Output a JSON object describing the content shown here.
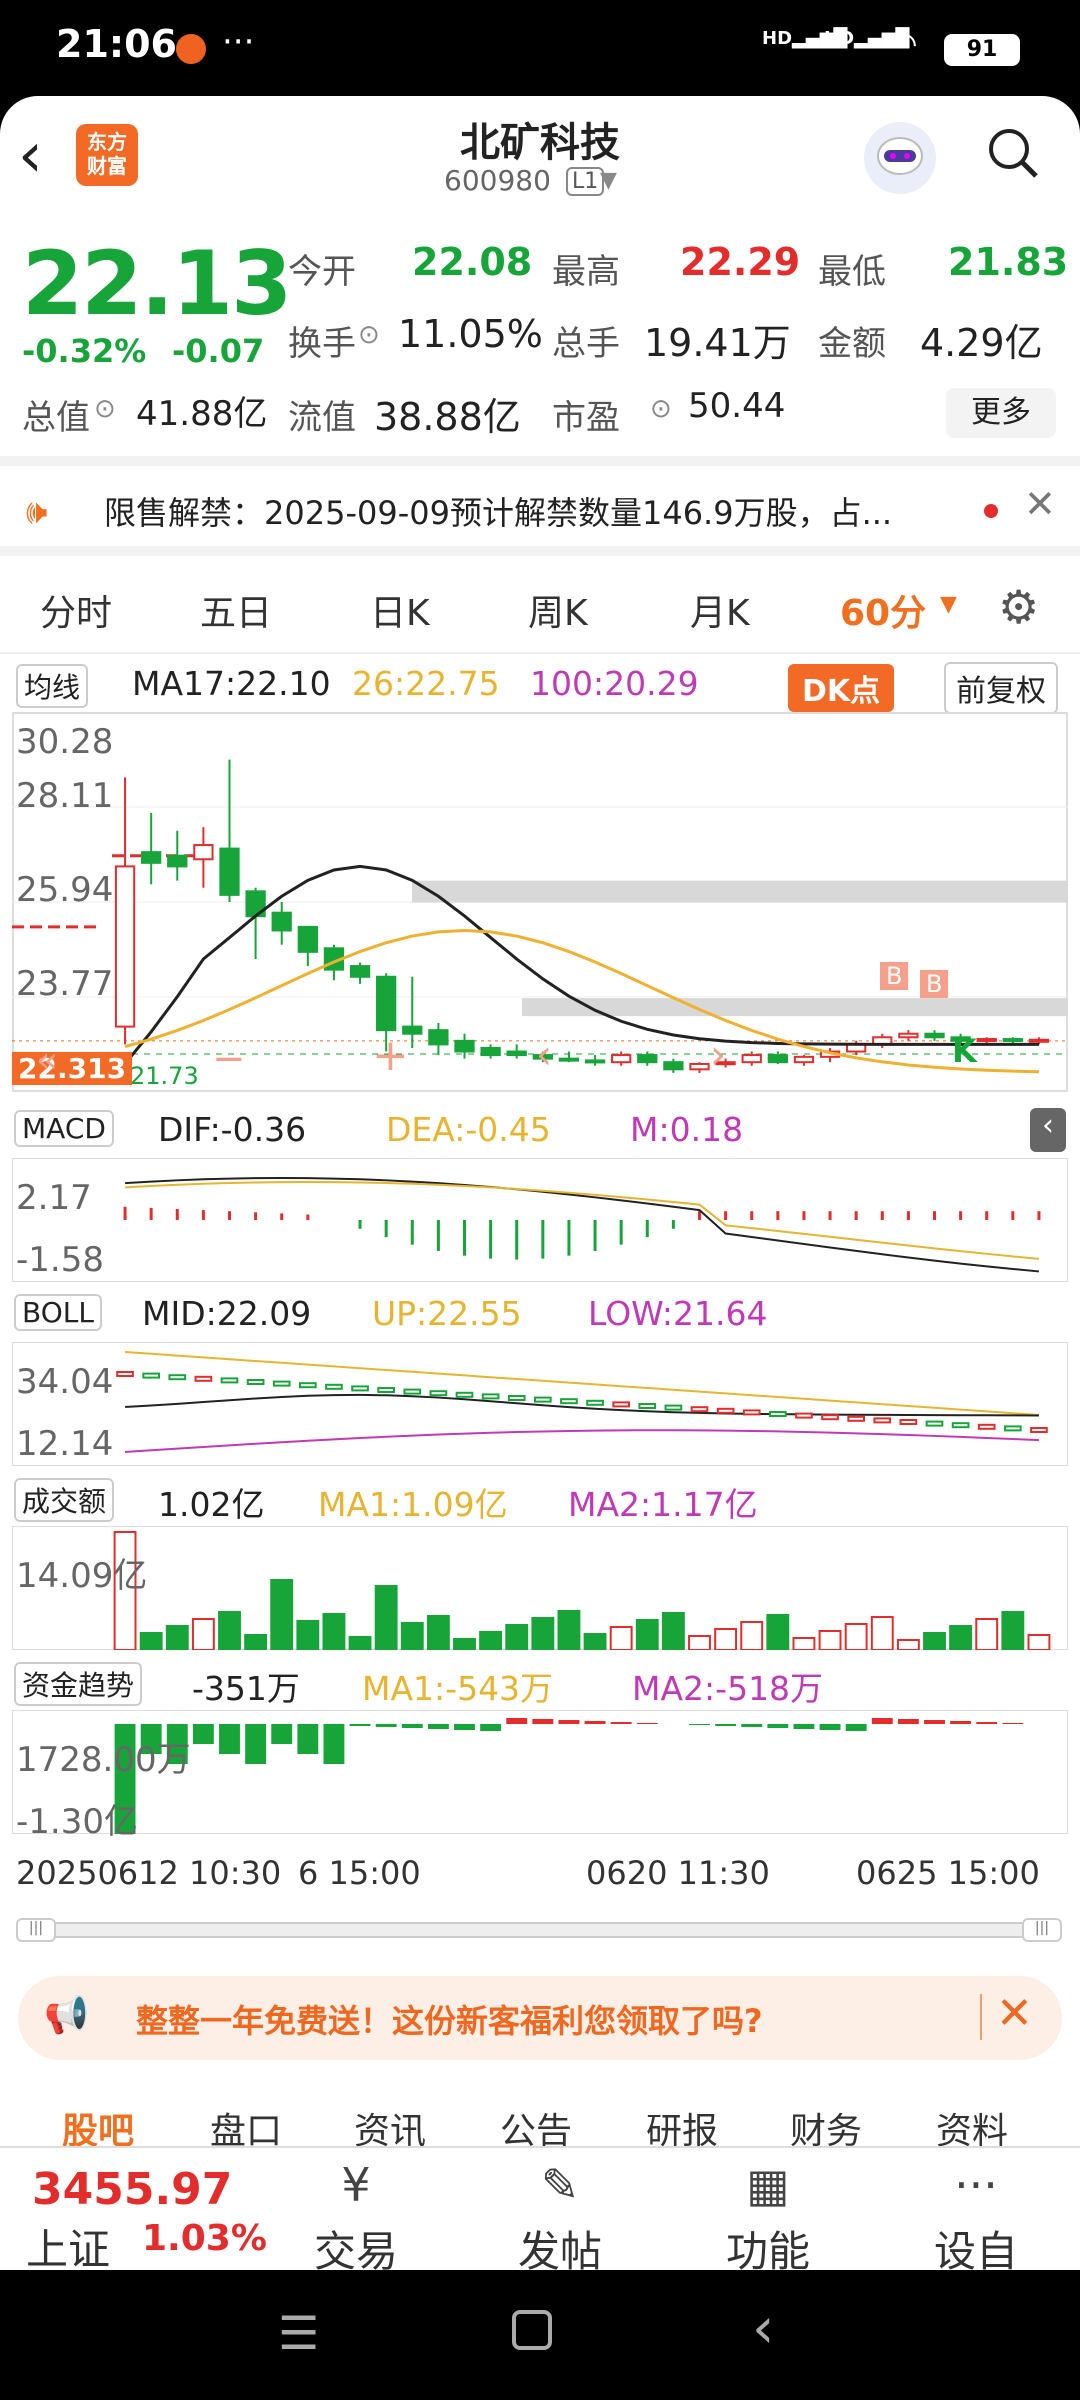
{
  "status": {
    "time": "21:06",
    "net1": "HD",
    "net2": "HD",
    "battery": "91"
  },
  "header": {
    "logo": "东方\n财富",
    "title": "北矿科技",
    "code": "600980",
    "level": "L1"
  },
  "quote": {
    "price": "22.13",
    "pct": "-0.32%",
    "chg": "-0.07",
    "row1": [
      {
        "l": "今开",
        "v": "22.08",
        "c": "green"
      },
      {
        "l": "最高",
        "v": "22.29",
        "c": "red"
      },
      {
        "l": "最低",
        "v": "21.83",
        "c": "green"
      }
    ],
    "row2": [
      {
        "l": "换手",
        "v": "11.05%"
      },
      {
        "l": "总手",
        "v": "19.41万"
      },
      {
        "l": "金额",
        "v": "4.29亿"
      }
    ],
    "row3": [
      {
        "l": "总值",
        "v": "41.88亿"
      },
      {
        "l": "流值",
        "v": "38.88亿"
      },
      {
        "l": "市盈",
        "v": "50.44"
      }
    ],
    "more": "更多"
  },
  "notice": {
    "text": "限售解禁：2025-09-09预计解禁数量146.9万股，占..."
  },
  "tabs": [
    "分时",
    "五日",
    "日K",
    "周K",
    "月K",
    "60分"
  ],
  "active_tab": "60分",
  "chart": {
    "ma_sel": "均线",
    "ma17": "MA17:22.10",
    "ma26": "26:22.75",
    "ma100": "100:20.29",
    "dk": "DK点",
    "fq": "前复权",
    "yticks": [
      "30.28",
      "28.11",
      "25.94",
      "23.77"
    ],
    "price_tag": "22.313",
    "low_tag": "21.73",
    "macd_sel": "MACD",
    "dif": "DIF:-0.36",
    "dea": "DEA:-0.45",
    "m": "M:0.18",
    "macd_hi": "2.17",
    "macd_lo": "-1.58",
    "boll_sel": "BOLL",
    "mid": "MID:22.09",
    "up": "UP:22.55",
    "low": "LOW:21.64",
    "boll_hi": "34.04",
    "boll_lo": "12.14",
    "vol_sel": "成交额",
    "vol": "1.02亿",
    "vma1": "MA1:1.09亿",
    "vma2": "MA2:1.17亿",
    "vol_hi": "14.09亿",
    "fund_sel": "资金趋势",
    "fund": "-351万",
    "fma1": "MA1:-543万",
    "fma2": "MA2:-518万",
    "fund_hi": "1728.00万",
    "fund_lo": "-1.30亿",
    "xlabels": [
      "20250612 10:30",
      "6 15:00",
      "0620 11:30",
      "0625 15:00"
    ],
    "bmarks": [
      "B",
      "B"
    ],
    "kmark": "K"
  },
  "chart_data": {
    "type": "candlestick",
    "title": "北矿科技 60分",
    "ylim": [
      21.0,
      31.0
    ],
    "candles": [
      [
        22.5,
        27.0,
        22.0,
        29.5
      ],
      [
        27.4,
        27.1,
        26.5,
        28.5
      ],
      [
        27.3,
        27.0,
        26.6,
        28.0
      ],
      [
        27.2,
        27.6,
        26.4,
        28.1
      ],
      [
        27.5,
        26.2,
        26.0,
        30.0
      ],
      [
        26.3,
        25.6,
        24.4,
        26.4
      ],
      [
        25.7,
        25.2,
        24.8,
        26.0
      ],
      [
        25.3,
        24.6,
        24.2,
        25.3
      ],
      [
        24.7,
        24.1,
        23.8,
        24.8
      ],
      [
        24.2,
        23.9,
        23.7,
        24.3
      ],
      [
        23.9,
        22.4,
        21.8,
        24.0
      ],
      [
        22.5,
        22.3,
        21.9,
        23.9
      ],
      [
        22.4,
        22.0,
        21.7,
        22.6
      ],
      [
        22.1,
        21.8,
        21.6,
        22.3
      ],
      [
        21.9,
        21.7,
        21.6,
        22.0
      ],
      [
        21.8,
        21.7,
        21.6,
        22.0
      ],
      [
        21.7,
        21.6,
        21.5,
        21.8
      ],
      [
        21.6,
        21.55,
        21.5,
        21.8
      ],
      [
        21.55,
        21.5,
        21.4,
        21.7
      ],
      [
        21.5,
        21.7,
        21.4,
        21.8
      ],
      [
        21.7,
        21.5,
        21.4,
        21.8
      ],
      [
        21.5,
        21.3,
        21.2,
        21.6
      ],
      [
        21.3,
        21.45,
        21.2,
        21.5
      ],
      [
        21.45,
        21.5,
        21.35,
        21.6
      ],
      [
        21.5,
        21.7,
        21.4,
        21.8
      ],
      [
        21.7,
        21.5,
        21.45,
        21.8
      ],
      [
        21.5,
        21.65,
        21.4,
        21.7
      ],
      [
        21.65,
        21.8,
        21.5,
        21.9
      ],
      [
        21.8,
        22.0,
        21.7,
        22.1
      ],
      [
        22.0,
        22.2,
        21.9,
        22.3
      ],
      [
        22.2,
        22.3,
        22.1,
        22.4
      ],
      [
        22.3,
        22.2,
        22.1,
        22.4
      ],
      [
        22.2,
        22.1,
        22.0,
        22.3
      ],
      [
        22.1,
        22.15,
        22.0,
        22.2
      ],
      [
        22.15,
        22.1,
        22.0,
        22.2
      ],
      [
        22.1,
        22.13,
        22.0,
        22.2
      ]
    ]
  },
  "banner": {
    "text": "整整一年免费送！这份新客福利您领取了吗?"
  },
  "bottom_tabs": [
    "股吧",
    "盘口",
    "资讯",
    "公告",
    "研报",
    "财务",
    "资料"
  ],
  "index": {
    "value": "3455.97",
    "name": "上证",
    "pct": "1.03%"
  },
  "bottom_nav": [
    {
      "icon": "¥",
      "label": "交易"
    },
    {
      "icon": "✎",
      "label": "发帖"
    },
    {
      "icon": "▦",
      "label": "功能"
    },
    {
      "icon": "···",
      "label": "设自选"
    }
  ],
  "colors": {
    "up": "#e32d2d",
    "down": "#17a53a",
    "accent": "#f07020"
  }
}
